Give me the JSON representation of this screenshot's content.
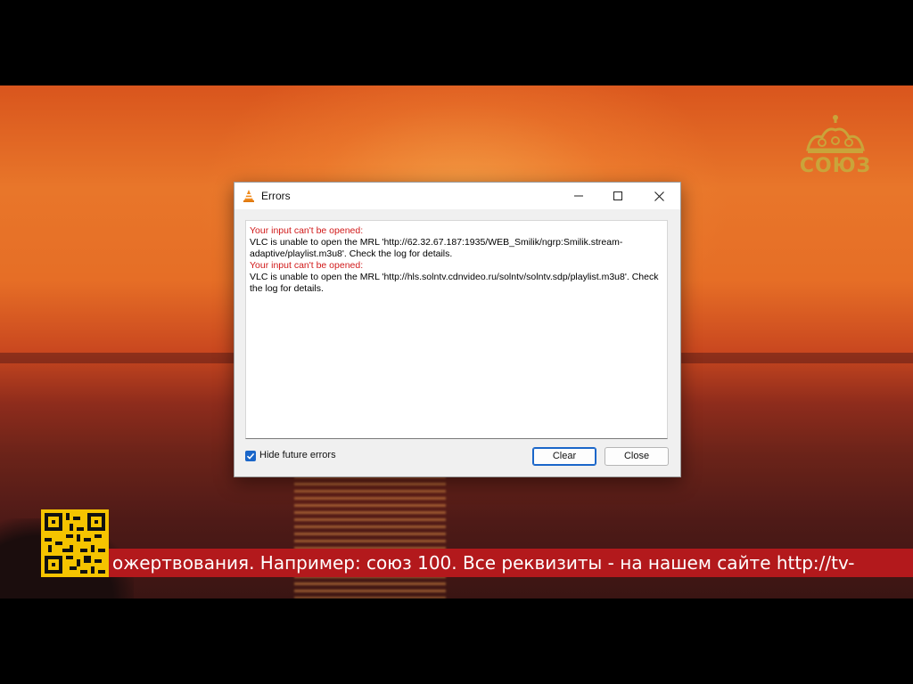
{
  "background": {
    "logo_text": "СОЮЗ",
    "ticker_text": "ожертвования. Например: союз 100. Все реквизиты - на нашем сайте http://tv-"
  },
  "dialog": {
    "title": "Errors",
    "app_icon": "vlc-cone-icon",
    "window_controls": [
      "minimize-icon",
      "maximize-icon",
      "close-icon"
    ],
    "messages": [
      {
        "heading": "Your input can't be opened:",
        "body": "VLC is unable to open the MRL 'http://62.32.67.187:1935/WEB_Smilik/ngrp:Smilik.stream-adaptive/playlist.m3u8'. Check the log for details."
      },
      {
        "heading": "Your input can't be opened:",
        "body": "VLC is unable to open the MRL 'http://hls.solntv.cdnvideo.ru/solntv/solntv.sdp/playlist.m3u8'. Check the log for details."
      }
    ],
    "hide_future_errors": {
      "label": "Hide future errors",
      "checked": true
    },
    "buttons": {
      "clear": "Clear",
      "close": "Close"
    },
    "colors": {
      "error_heading": "#d11a1a",
      "accent": "#1a66c9"
    }
  }
}
